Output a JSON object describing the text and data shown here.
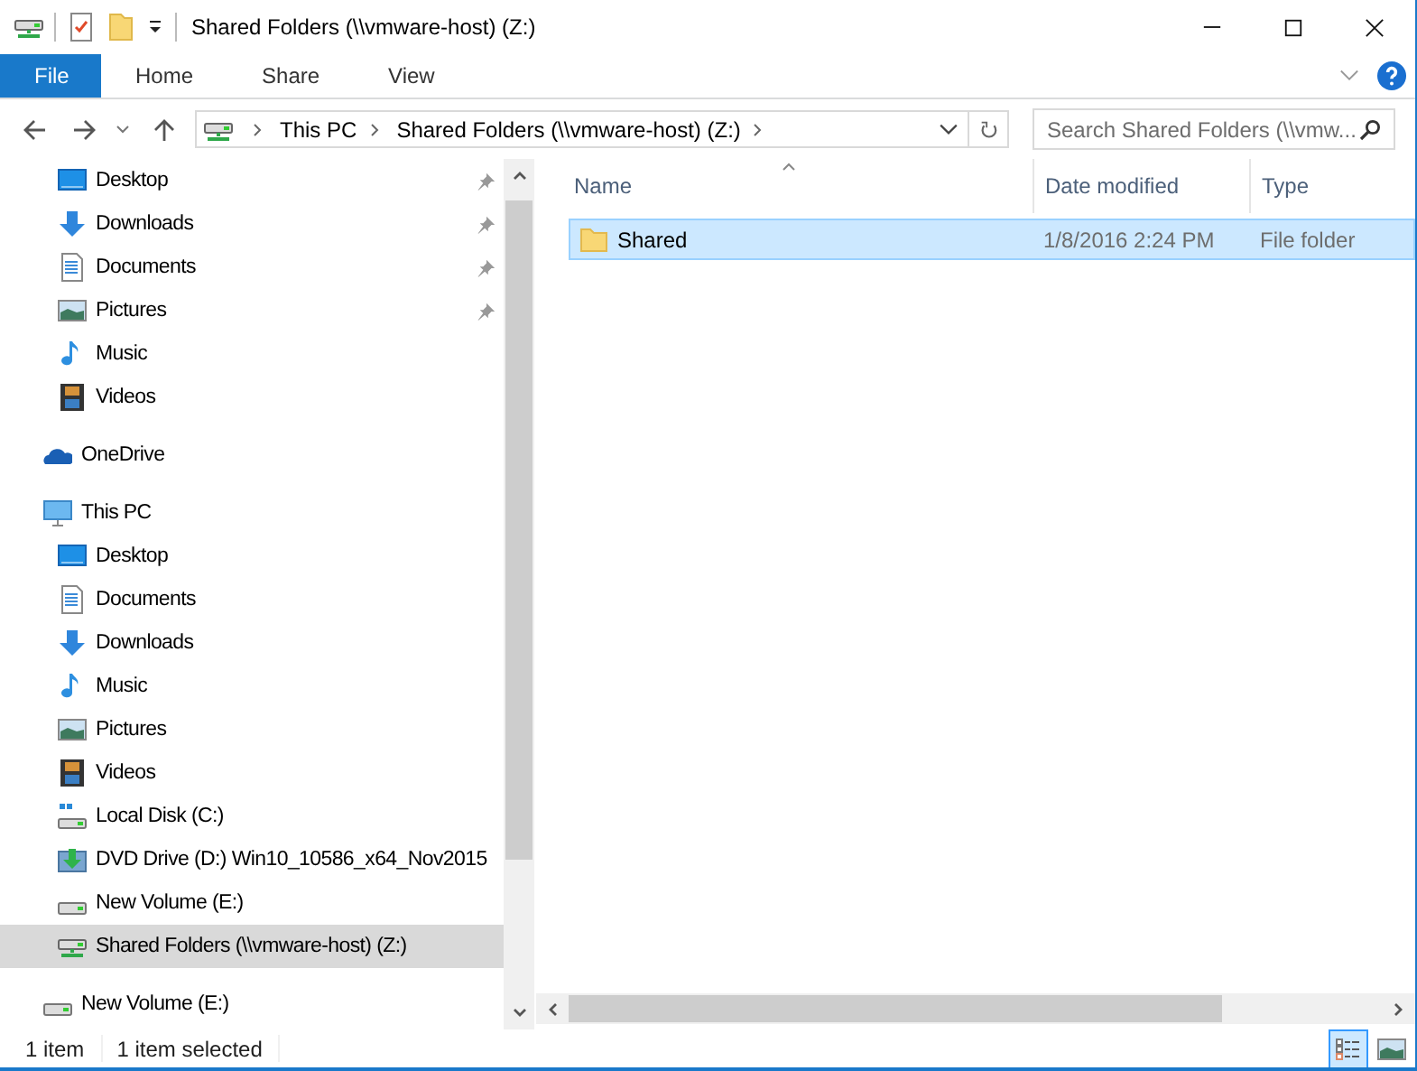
{
  "window": {
    "title": "Shared Folders (\\\\vmware-host) (Z:)"
  },
  "ribbon_tabs": [
    {
      "label": "File",
      "selected": true
    },
    {
      "label": "Home",
      "selected": false
    },
    {
      "label": "Share",
      "selected": false
    },
    {
      "label": "View",
      "selected": false
    }
  ],
  "address_bar": {
    "segments": [
      "This PC",
      "Shared Folders (\\\\vmware-host) (Z:)"
    ]
  },
  "search": {
    "placeholder": "Search Shared Folders (\\\\vmw..."
  },
  "quick_access": [
    {
      "label": "Desktop",
      "kind": "desktop",
      "pinned": true,
      "selected": false
    },
    {
      "label": "Downloads",
      "kind": "downloads",
      "pinned": true,
      "selected": false
    },
    {
      "label": "Documents",
      "kind": "documents",
      "pinned": true,
      "selected": false
    },
    {
      "label": "Pictures",
      "kind": "pictures",
      "pinned": true,
      "selected": false
    },
    {
      "label": "Music",
      "kind": "music",
      "pinned": false,
      "selected": false
    },
    {
      "label": "Videos",
      "kind": "videos",
      "pinned": false,
      "selected": false
    }
  ],
  "tree": [
    {
      "label": "OneDrive",
      "kind": "onedrive",
      "selected": false
    },
    {
      "label": "This PC",
      "kind": "pc",
      "selected": false,
      "children": [
        {
          "label": "Desktop",
          "kind": "desktop",
          "selected": false
        },
        {
          "label": "Documents",
          "kind": "documents",
          "selected": false
        },
        {
          "label": "Downloads",
          "kind": "downloads",
          "selected": false
        },
        {
          "label": "Music",
          "kind": "music",
          "selected": false
        },
        {
          "label": "Pictures",
          "kind": "pictures",
          "selected": false
        },
        {
          "label": "Videos",
          "kind": "videos",
          "selected": false
        },
        {
          "label": "Local Disk (C:)",
          "kind": "localdisk",
          "selected": false
        },
        {
          "label": "DVD Drive (D:) Win10_10586_x64_Nov2015",
          "kind": "dvd",
          "selected": false
        },
        {
          "label": "New Volume (E:)",
          "kind": "drive",
          "selected": false
        },
        {
          "label": "Shared Folders (\\\\vmware-host) (Z:)",
          "kind": "netdrive",
          "selected": true
        }
      ]
    },
    {
      "label": "New Volume (E:)",
      "kind": "drive",
      "selected": false
    }
  ],
  "table": {
    "columns": [
      {
        "label": "Name",
        "sorted": true
      },
      {
        "label": "Date modified",
        "sorted": false
      },
      {
        "label": "Type",
        "sorted": false
      }
    ],
    "rows": [
      {
        "name": "Shared",
        "date_modified": "1/8/2016 2:24 PM",
        "type": "File folder",
        "selected": true
      }
    ]
  },
  "status_bar": {
    "count": "1 item",
    "selection": "1 item selected"
  },
  "view_buttons": [
    {
      "kind": "details",
      "selected": true
    },
    {
      "kind": "large-icons",
      "selected": false
    }
  ]
}
